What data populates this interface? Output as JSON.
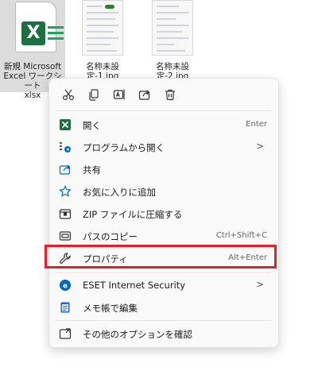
{
  "desktop": {
    "files": [
      {
        "name_line1": "新規 Microsoft",
        "name_line2": "Excel ワークシート",
        "name_line3": "xlsx",
        "badge": "X"
      },
      {
        "name": "名称未設定-1.jpg"
      },
      {
        "name": "名称未設定-2.jpg"
      }
    ]
  },
  "context_menu": {
    "quick_actions": [
      {
        "icon": "cut-icon"
      },
      {
        "icon": "copy-icon"
      },
      {
        "icon": "rename-icon"
      },
      {
        "icon": "share-icon"
      },
      {
        "icon": "delete-icon"
      }
    ],
    "items": [
      {
        "label": "開く",
        "shortcut": "Enter",
        "icon": "excel-icon"
      },
      {
        "label": "プログラムから開く",
        "chevron": ">",
        "icon": "open-with-icon"
      },
      {
        "label": "共有",
        "icon": "share-icon"
      },
      {
        "label": "お気に入りに追加",
        "icon": "star-icon"
      },
      {
        "label": "ZIP ファイルに圧縮する",
        "icon": "zip-icon"
      },
      {
        "label": "パスのコピー",
        "shortcut": "Ctrl+Shift+C",
        "icon": "copy-path-icon"
      },
      {
        "label": "プロパティ",
        "shortcut": "Alt+Enter",
        "icon": "wrench-icon"
      },
      {
        "label": "ESET Internet Security",
        "chevron": ">",
        "icon": "eset-icon"
      },
      {
        "label": "メモ帳で編集",
        "icon": "notepad-icon"
      },
      {
        "label": "その他のオプションを確認",
        "icon": "more-options-icon"
      }
    ]
  },
  "colors": {
    "excel_green": "#1d6f42",
    "highlight_red": "#e0202a",
    "accent_blue": "#0067c0"
  }
}
